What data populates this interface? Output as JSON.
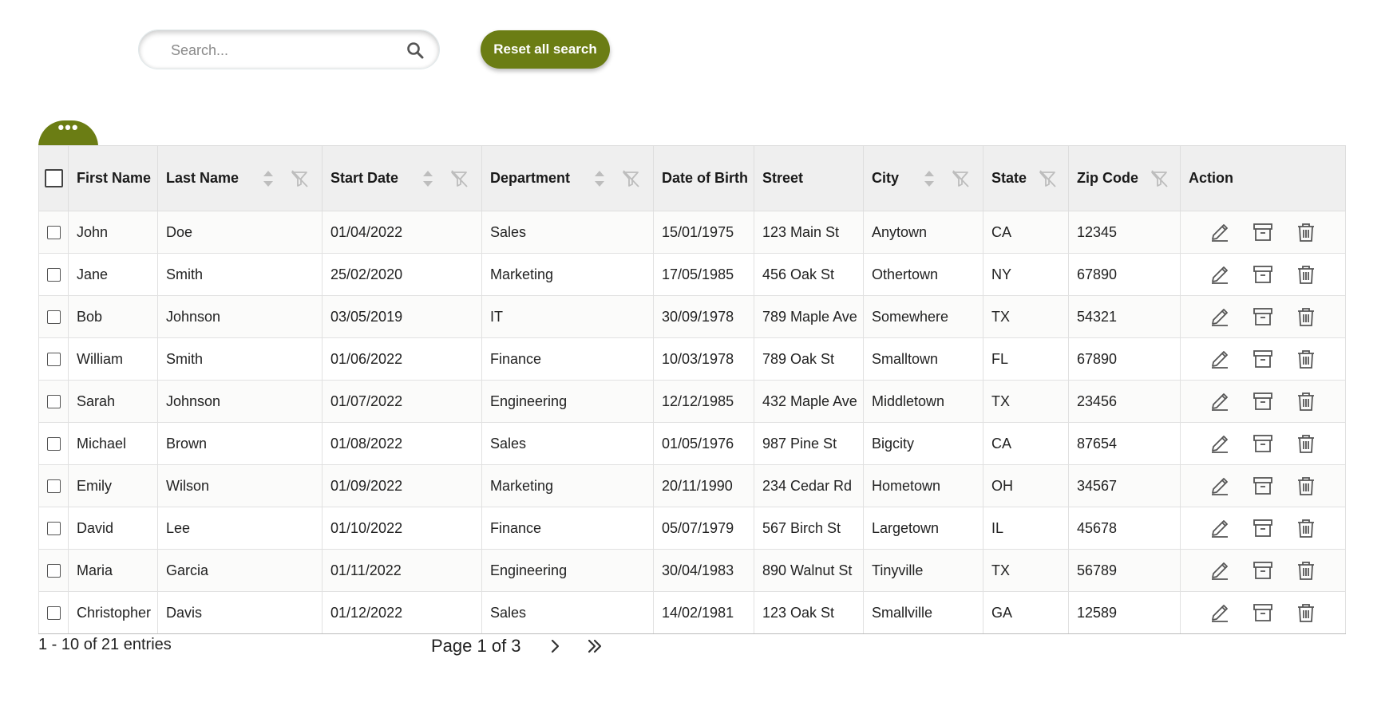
{
  "search": {
    "placeholder": "Search...",
    "value": ""
  },
  "reset_button": {
    "label": "Reset all search"
  },
  "menu_tab": {
    "label": "•••"
  },
  "columns": {
    "first_name": "First Name",
    "last_name": "Last Name",
    "start_date": "Start Date",
    "department": "Department",
    "dob": "Date of Birth",
    "street": "Street",
    "city": "City",
    "state": "State",
    "zip": "Zip Code",
    "action": "Action"
  },
  "rows": [
    {
      "first": "John",
      "last": "Doe",
      "start": "01/04/2022",
      "dept": "Sales",
      "dob": "15/01/1975",
      "street": "123 Main St",
      "city": "Anytown",
      "state": "CA",
      "zip": "12345"
    },
    {
      "first": "Jane",
      "last": "Smith",
      "start": "25/02/2020",
      "dept": "Marketing",
      "dob": "17/05/1985",
      "street": "456 Oak St",
      "city": "Othertown",
      "state": "NY",
      "zip": "67890"
    },
    {
      "first": "Bob",
      "last": "Johnson",
      "start": "03/05/2019",
      "dept": "IT",
      "dob": "30/09/1978",
      "street": "789 Maple Ave",
      "city": "Somewhere",
      "state": "TX",
      "zip": "54321"
    },
    {
      "first": "William",
      "last": "Smith",
      "start": "01/06/2022",
      "dept": "Finance",
      "dob": "10/03/1978",
      "street": "789 Oak St",
      "city": "Smalltown",
      "state": "FL",
      "zip": "67890"
    },
    {
      "first": "Sarah",
      "last": "Johnson",
      "start": "01/07/2022",
      "dept": "Engineering",
      "dob": "12/12/1985",
      "street": "432 Maple Ave",
      "city": "Middletown",
      "state": "TX",
      "zip": "23456"
    },
    {
      "first": "Michael",
      "last": "Brown",
      "start": "01/08/2022",
      "dept": "Sales",
      "dob": "01/05/1976",
      "street": "987 Pine St",
      "city": "Bigcity",
      "state": "CA",
      "zip": "87654"
    },
    {
      "first": "Emily",
      "last": "Wilson",
      "start": "01/09/2022",
      "dept": "Marketing",
      "dob": "20/11/1990",
      "street": "234 Cedar Rd",
      "city": "Hometown",
      "state": "OH",
      "zip": "34567"
    },
    {
      "first": "David",
      "last": "Lee",
      "start": "01/10/2022",
      "dept": "Finance",
      "dob": "05/07/1979",
      "street": "567 Birch St",
      "city": "Largetown",
      "state": "IL",
      "zip": "45678"
    },
    {
      "first": "Maria",
      "last": "Garcia",
      "start": "01/11/2022",
      "dept": "Engineering",
      "dob": "30/04/1983",
      "street": "890 Walnut St",
      "city": "Tinyville",
      "state": "TX",
      "zip": "56789"
    },
    {
      "first": "Christopher",
      "last": "Davis",
      "start": "01/12/2022",
      "dept": "Sales",
      "dob": "14/02/1981",
      "street": "123 Oak St",
      "city": "Smallville",
      "state": "GA",
      "zip": "12589"
    }
  ],
  "footer": {
    "count": "1 - 10 of 21 entries",
    "page": "Page 1 of 3"
  },
  "colors": {
    "accent": "#6b7d14",
    "header_bg": "#efefef",
    "icon": "#555555"
  },
  "icons": {
    "search": "search-icon",
    "sort": "sort-icon",
    "filter": "filter-off-icon",
    "edit": "edit-pencil-icon",
    "archive": "archive-icon",
    "delete": "trash-icon",
    "next": "chevron-right-icon",
    "last": "double-chevron-right-icon"
  }
}
